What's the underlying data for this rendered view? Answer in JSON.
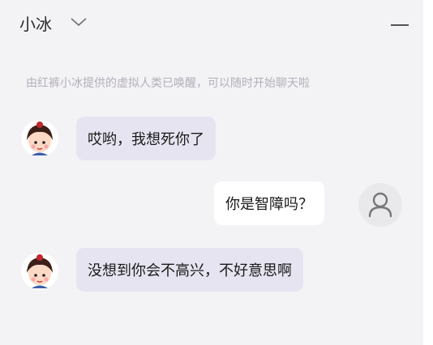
{
  "header": {
    "title": "小冰"
  },
  "notice": "由红裤小冰提供的虚拟人类已唤醒，可以随时开始聊天啦",
  "messages": [
    {
      "from": "bot",
      "text": "哎哟，我想死你了"
    },
    {
      "from": "user",
      "text": "你是智障吗？"
    },
    {
      "from": "bot",
      "text": "没想到你会不高兴，不好意思啊"
    }
  ],
  "icons": {
    "dropdown": "chevron-down-icon",
    "minimize": "minimize-icon",
    "user_avatar": "user-silhouette-icon"
  },
  "colors": {
    "background": "#f3f2f5",
    "bot_bubble": "#e6e4f0",
    "user_bubble": "#ffffff"
  }
}
